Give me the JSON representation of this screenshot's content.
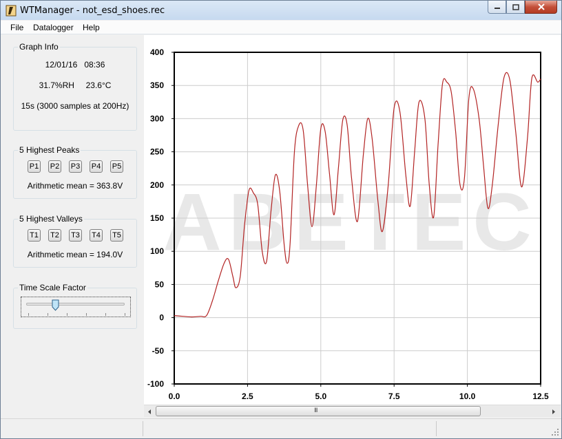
{
  "window": {
    "title": "WTManager - not_esd_shoes.rec"
  },
  "menu": {
    "items": [
      "File",
      "Datalogger",
      "Help"
    ]
  },
  "graph_info": {
    "title": "Graph Info",
    "date": "12/01/16",
    "time": "08:36",
    "humidity": "31.7%RH",
    "temperature": "23.6°C",
    "duration": "15s (3000 samples at 200Hz)"
  },
  "peaks": {
    "title": "5 Highest Peaks",
    "buttons": [
      "P1",
      "P2",
      "P3",
      "P4",
      "P5"
    ],
    "mean": "Arithmetic mean = 363.8V"
  },
  "valleys": {
    "title": "5 Highest Valleys",
    "buttons": [
      "T1",
      "T2",
      "T3",
      "T4",
      "T5"
    ],
    "mean": "Arithmetic mean = 194.0V"
  },
  "time_scale": {
    "title": "Time Scale Factor",
    "level": 0.3
  },
  "scrollbar": {
    "grip": "III"
  },
  "colors": {
    "trace": "#b22222",
    "grid": "#cccccc",
    "watermark": "#e8e8e8"
  },
  "watermark": "ABETEC",
  "chart_data": {
    "type": "line",
    "xlim": [
      0,
      12.5
    ],
    "ylim": [
      -100,
      400
    ],
    "xticks": [
      "0.0",
      "2.5",
      "5.0",
      "7.5",
      "10.0",
      "12.5"
    ],
    "yticks": [
      "400",
      "350",
      "300",
      "250",
      "200",
      "150",
      "100",
      "50",
      "0",
      "-50",
      "-100"
    ],
    "grid": true,
    "series": [
      {
        "color": "#b22222",
        "x": [
          0.0,
          0.3,
          0.6,
          0.9,
          1.1,
          1.3,
          1.5,
          1.7,
          1.85,
          2.0,
          2.1,
          2.25,
          2.4,
          2.55,
          2.7,
          2.85,
          3.0,
          3.15,
          3.3,
          3.45,
          3.6,
          3.75,
          3.85,
          3.95,
          4.1,
          4.25,
          4.4,
          4.55,
          4.7,
          4.85,
          5.0,
          5.15,
          5.3,
          5.45,
          5.6,
          5.75,
          5.9,
          6.05,
          6.25,
          6.45,
          6.6,
          6.75,
          6.95,
          7.1,
          7.3,
          7.5,
          7.7,
          7.9,
          8.05,
          8.2,
          8.35,
          8.55,
          8.7,
          8.85,
          9.0,
          9.15,
          9.3,
          9.45,
          9.6,
          9.75,
          9.9,
          10.05,
          10.2,
          10.4,
          10.55,
          10.7,
          10.85,
          11.05,
          11.25,
          11.45,
          11.65,
          11.85,
          12.05,
          12.2,
          12.4,
          12.5
        ],
        "y": [
          3,
          2,
          1,
          2,
          3,
          25,
          55,
          82,
          88,
          62,
          45,
          62,
          140,
          192,
          188,
          170,
          100,
          85,
          160,
          215,
          190,
          110,
          82,
          110,
          250,
          290,
          282,
          200,
          137,
          200,
          285,
          280,
          215,
          155,
          225,
          298,
          290,
          210,
          145,
          245,
          300,
          270,
          175,
          130,
          200,
          316,
          310,
          215,
          168,
          250,
          325,
          300,
          200,
          152,
          260,
          352,
          355,
          340,
          280,
          200,
          210,
          330,
          345,
          300,
          230,
          165,
          200,
          290,
          362,
          358,
          280,
          197,
          270,
          361,
          355,
          360
        ]
      }
    ]
  }
}
